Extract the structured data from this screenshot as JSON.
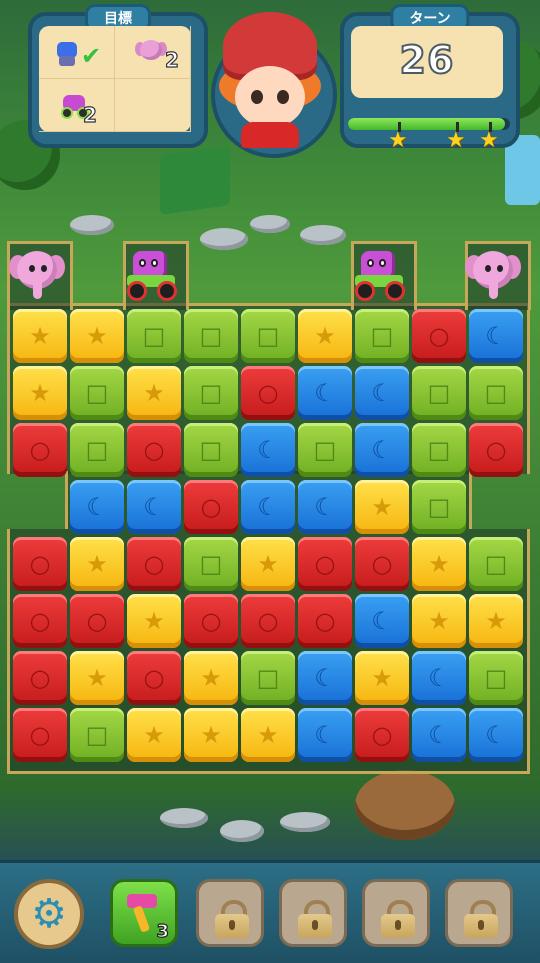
{
  "hud": {
    "goals_title": "目標",
    "goals": [
      {
        "icon": "robot-icon",
        "status": "check-icon",
        "count": ""
      },
      {
        "icon": "elephant-icon",
        "status": "",
        "count": "2"
      },
      {
        "icon": "tractor-icon",
        "status": "",
        "count": "2"
      }
    ],
    "turns_title": "ターン",
    "turns_left": "26",
    "progress_fraction": 0.97,
    "stars_total": 3
  },
  "board": {
    "cols": 9,
    "rows": 8,
    "toys_top": [
      {
        "type": "elephant",
        "col": 0
      },
      {
        "type": "tractor",
        "col": 2
      },
      {
        "type": "tractor",
        "col": 6
      },
      {
        "type": "elephant",
        "col": 8
      }
    ],
    "tiles": [
      [
        "Y",
        "Y",
        "G",
        "G",
        "G",
        "Y",
        "G",
        "R",
        "B"
      ],
      [
        "Y",
        "G",
        "Y",
        "G",
        "R",
        "B",
        "B",
        "G",
        "G"
      ],
      [
        "R",
        "G",
        "R",
        "G",
        "B",
        "G",
        "B",
        "G",
        "R"
      ],
      [
        "",
        "B",
        "B",
        "R",
        "B",
        "B",
        "Y",
        "G",
        ""
      ],
      [
        "R",
        "Y",
        "R",
        "G",
        "Y",
        "R",
        "R",
        "Y",
        "G"
      ],
      [
        "R",
        "R",
        "Y",
        "R",
        "R",
        "R",
        "B",
        "Y",
        "Y"
      ],
      [
        "R",
        "Y",
        "R",
        "Y",
        "G",
        "B",
        "Y",
        "B",
        "G"
      ],
      [
        "R",
        "G",
        "Y",
        "Y",
        "Y",
        "B",
        "R",
        "B",
        "B"
      ]
    ],
    "symbols": {
      "Y": "★",
      "G": "□",
      "R": "○",
      "B": "☾"
    },
    "colors": {
      "Y": "#f6c21a",
      "G": "#7dbb2c",
      "R": "#d12626",
      "B": "#1f86e6"
    }
  },
  "bottom": {
    "settings_icon": "gear-icon",
    "booster_icon": "hammer-icon",
    "booster_count": "3",
    "locked_slots": 4
  }
}
